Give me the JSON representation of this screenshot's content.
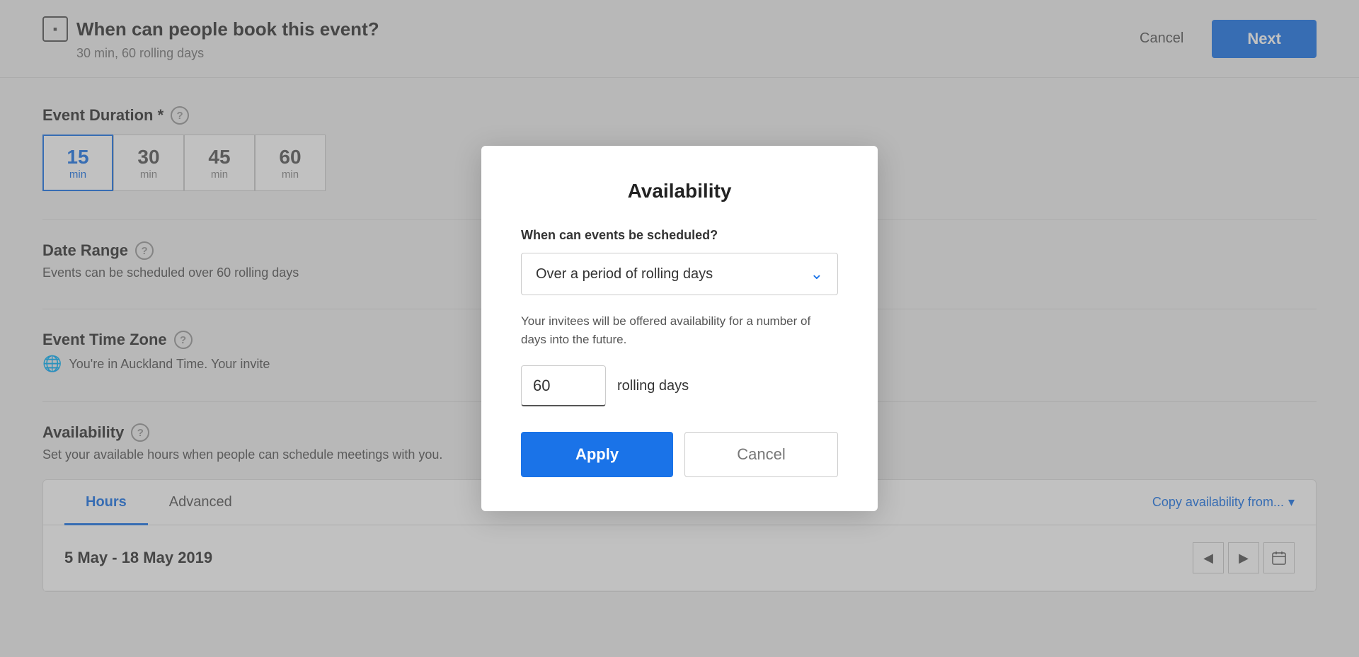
{
  "topbar": {
    "event_icon": "▪",
    "title": "When can people book this event?",
    "subtitle": "30 min, 60 rolling days",
    "cancel_label": "Cancel",
    "next_label": "Next"
  },
  "event_duration": {
    "label": "Event Duration *",
    "options": [
      {
        "num": "15",
        "unit": "min",
        "active": true
      },
      {
        "num": "30",
        "unit": "min",
        "active": false
      },
      {
        "num": "45",
        "unit": "min",
        "active": false
      },
      {
        "num": "60",
        "unit": "min",
        "active": false
      }
    ]
  },
  "date_range": {
    "label": "Date Range",
    "text": "Events can be scheduled over 60 rolling days"
  },
  "timezone": {
    "label": "Event Time Zone",
    "text": "You're in Auckland Time. Your invite"
  },
  "availability": {
    "label": "Availability",
    "description": "Set your available hours when people can schedule meetings with you."
  },
  "hours_tabs": {
    "tabs": [
      {
        "label": "Hours",
        "active": true
      },
      {
        "label": "Advanced",
        "active": false
      }
    ],
    "copy_label": "Copy availability from...",
    "date_range_label": "5 May - 18 May 2019"
  },
  "modal": {
    "title": "Availability",
    "question": "When can events be scheduled?",
    "dropdown_value": "Over a period of rolling days",
    "description": "Your invitees will be offered availability for a number of days into the future.",
    "rolling_days_value": "60",
    "rolling_days_suffix": "rolling days",
    "apply_label": "Apply",
    "cancel_label": "Cancel"
  }
}
